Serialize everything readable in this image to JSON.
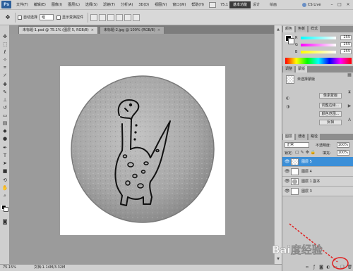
{
  "app": {
    "logo": "Ps",
    "menus": [
      "文件(F)",
      "编辑(E)",
      "图像(I)",
      "图层(L)",
      "选择(S)",
      "滤镜(T)",
      "分析(A)",
      "3D(D)",
      "视图(V)",
      "窗口(W)",
      "帮助(H)"
    ],
    "zoom_display": "75.1",
    "workspaces": [
      "基本功能",
      "设计",
      "绘画"
    ],
    "cs_live": "CS Live"
  },
  "options_bar": {
    "auto_select_label": "自动选择",
    "auto_select_value": "组",
    "show_transform_label": "显示变换控件"
  },
  "document_tabs": [
    {
      "label": "未标题-1.psd @ 75.1% (图层 5, RGB/8)",
      "active": true
    },
    {
      "label": "未标题-2.jpg @ 100% (RGB/8)",
      "active": false
    }
  ],
  "status_bar": {
    "zoom": "75.15%",
    "doc_info": "文档:1.14M/3.32M"
  },
  "color_panel": {
    "tab_labels": [
      "颜色",
      "色板",
      "样式"
    ],
    "r": "255",
    "g": "255",
    "b": "255"
  },
  "adjust_panel": {
    "tab_labels": [
      "调整",
      "蒙版"
    ],
    "title": "未选择蒙版",
    "buttons": [
      "像素蒙版",
      "调整边缘...",
      "颜色范围...",
      "反相"
    ]
  },
  "layers_panel": {
    "tab_labels": [
      "图层",
      "通道",
      "路径"
    ],
    "blend_mode": "正常",
    "opacity_label": "不透明度:",
    "opacity_value": "100%",
    "lock_label": "锁定:",
    "fill_label": "填充:",
    "fill_value": "100%",
    "layers": [
      {
        "name": "图层 5",
        "selected": true
      },
      {
        "name": "图层 4",
        "selected": false
      },
      {
        "name": "图层 1 副本",
        "selected": false
      },
      {
        "name": "图层 3",
        "selected": false
      }
    ]
  },
  "watermark": "Bai度经验"
}
